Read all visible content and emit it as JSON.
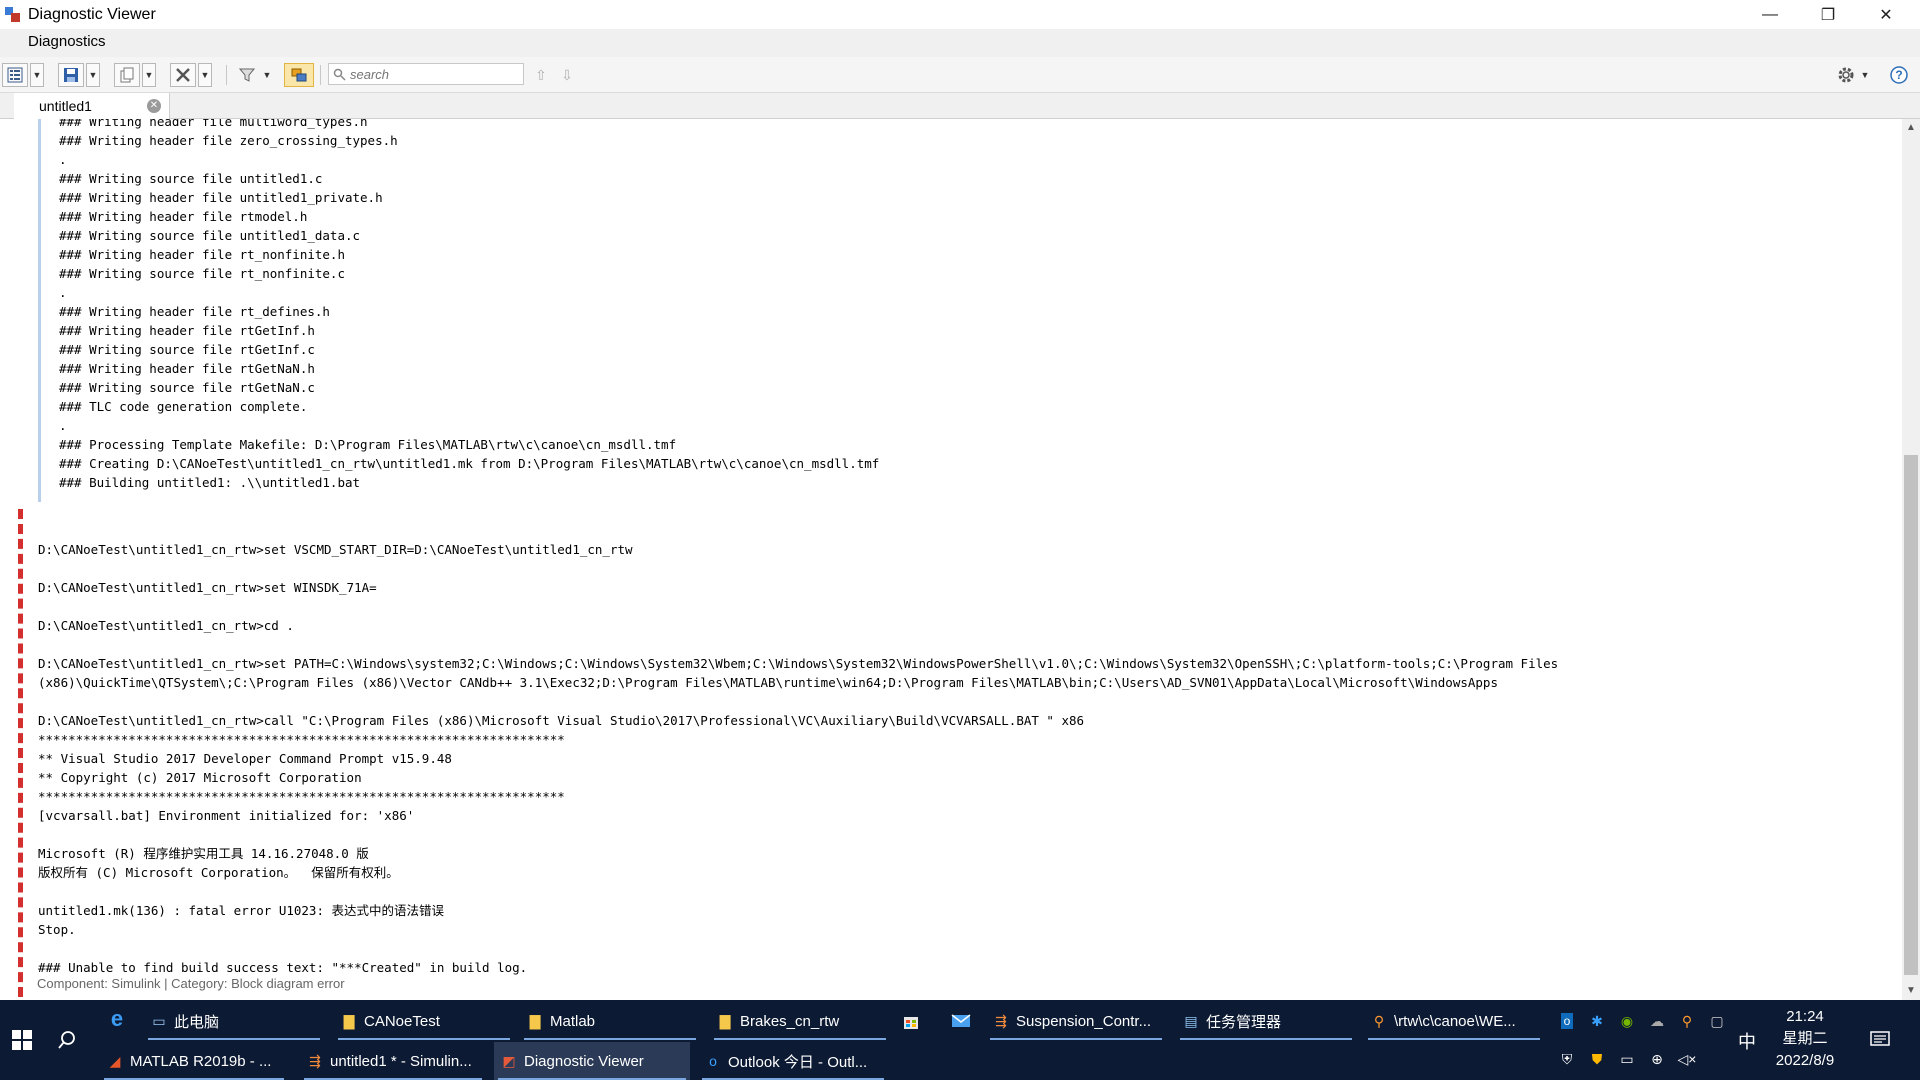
{
  "window": {
    "title": "Diagnostic Viewer",
    "minimize": "—",
    "restore": "❐",
    "close": "✕"
  },
  "menu": {
    "tab_label": "Diagnostics"
  },
  "toolbar": {
    "search_placeholder": "search"
  },
  "doc_tab": {
    "label": "untitled1",
    "close_glyph": "✕"
  },
  "info_log_lines": [
    "### Writing header file multiword_types.h",
    "### Writing header file zero_crossing_types.h",
    ".",
    "### Writing source file untitled1.c",
    "### Writing header file untitled1_private.h",
    "### Writing header file rtmodel.h",
    "### Writing source file untitled1_data.c",
    "### Writing header file rt_nonfinite.h",
    "### Writing source file rt_nonfinite.c",
    ".",
    "### Writing header file rt_defines.h",
    "### Writing header file rtGetInf.h",
    "### Writing source file rtGetInf.c",
    "### Writing header file rtGetNaN.h",
    "### Writing source file rtGetNaN.c",
    "### TLC code generation complete.",
    ".",
    "### Processing Template Makefile: D:\\Program Files\\MATLAB\\rtw\\c\\canoe\\cn_msdll.tmf",
    "### Creating D:\\CANoeTest\\untitled1_cn_rtw\\untitled1.mk from D:\\Program Files\\MATLAB\\rtw\\c\\canoe\\cn_msdll.tmf",
    "### Building untitled1: .\\\\untitled1.bat"
  ],
  "error_log_lines": [
    "",
    "D:\\CANoeTest\\untitled1_cn_rtw>set VSCMD_START_DIR=D:\\CANoeTest\\untitled1_cn_rtw",
    "",
    "D:\\CANoeTest\\untitled1_cn_rtw>set WINSDK_71A=",
    "",
    "D:\\CANoeTest\\untitled1_cn_rtw>cd .",
    "",
    "D:\\CANoeTest\\untitled1_cn_rtw>set PATH=C:\\Windows\\system32;C:\\Windows;C:\\Windows\\System32\\Wbem;C:\\Windows\\System32\\WindowsPowerShell\\v1.0\\;C:\\Windows\\System32\\OpenSSH\\;C:\\platform-tools;C:\\Program Files",
    "(x86)\\QuickTime\\QTSystem\\;C:\\Program Files (x86)\\Vector CANdb++ 3.1\\Exec32;D:\\Program Files\\MATLAB\\runtime\\win64;D:\\Program Files\\MATLAB\\bin;C:\\Users\\AD_SVN01\\AppData\\Local\\Microsoft\\WindowsApps",
    "",
    "D:\\CANoeTest\\untitled1_cn_rtw>call \"C:\\Program Files (x86)\\Microsoft Visual Studio\\2017\\Professional\\VC\\Auxiliary\\Build\\VCVARSALL.BAT \" x86",
    "**********************************************************************",
    "** Visual Studio 2017 Developer Command Prompt v15.9.48",
    "** Copyright (c) 2017 Microsoft Corporation",
    "**********************************************************************",
    "[vcvarsall.bat] Environment initialized for: 'x86'",
    "",
    "Microsoft (R) 程序维护实用工具 14.16.27048.0 版",
    "版权所有 (C) Microsoft Corporation。  保留所有权利。",
    "",
    "untitled1.mk(136) : fatal error U1023: 表达式中的语法错误",
    "Stop.",
    "",
    "### Unable to find build success text: \"***Created\" in build log."
  ],
  "component_line": "Component:  Simulink | Category:  Block diagram error",
  "taskbar": {
    "row1": [
      {
        "label": "此电脑",
        "icon": "this-pc-icon"
      },
      {
        "label": "CANoeTest",
        "icon": "folder-icon"
      },
      {
        "label": "Matlab",
        "icon": "folder-icon"
      },
      {
        "label": "Brakes_cn_rtw",
        "icon": "folder-icon"
      },
      {
        "label": "Suspension_Contr...",
        "icon": "simulink-icon"
      },
      {
        "label": "任务管理器",
        "icon": "task-manager-icon"
      },
      {
        "label": "\\rtw\\c\\canoe\\WE...",
        "icon": "search-folder-icon"
      }
    ],
    "row2": [
      {
        "label": "MATLAB R2019b - ...",
        "icon": "matlab-icon"
      },
      {
        "label": "untitled1 * - Simulin...",
        "icon": "simulink-icon"
      },
      {
        "label": "Diagnostic Viewer",
        "icon": "diagnostic-icon"
      },
      {
        "label": "Outlook 今日 - Outl...",
        "icon": "outlook-icon"
      }
    ],
    "ime": "中",
    "time": "21:24",
    "weekday": "星期二",
    "date": "2022/8/9",
    "colors": {
      "background": "#0c1a33",
      "underline": "#7aa7e0"
    }
  }
}
